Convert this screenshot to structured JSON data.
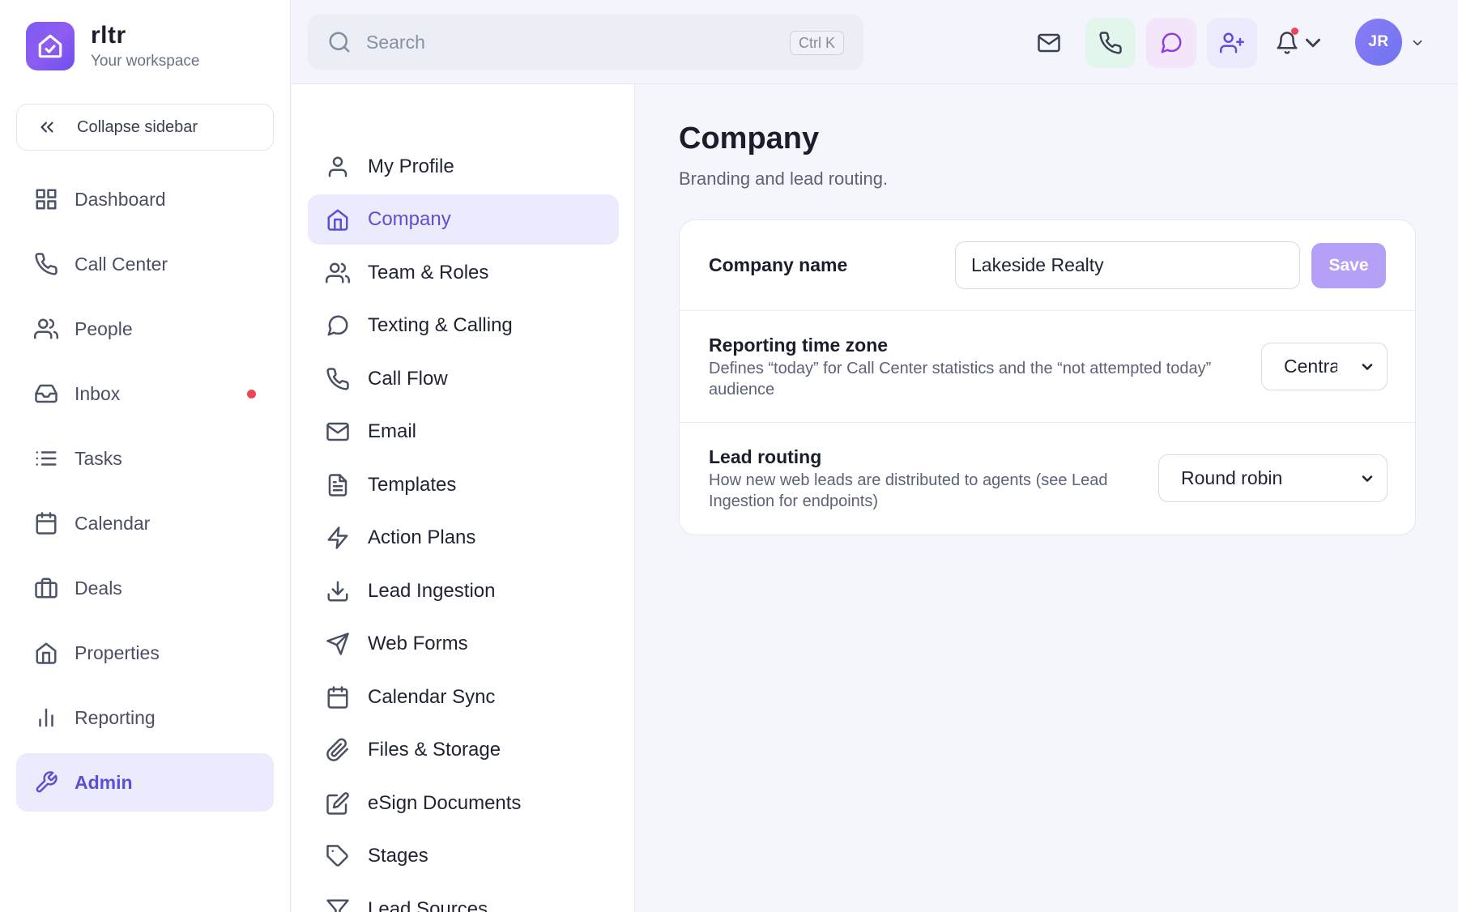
{
  "app": {
    "name": "rltr",
    "workspace": "Your workspace"
  },
  "sidebar": {
    "collapse_label": "Collapse sidebar",
    "items": [
      {
        "label": "Dashboard",
        "icon": "grid-icon"
      },
      {
        "label": "Call Center",
        "icon": "phone-icon"
      },
      {
        "label": "People",
        "icon": "users-icon"
      },
      {
        "label": "Inbox",
        "icon": "inbox-icon",
        "badge": "unread-dot"
      },
      {
        "label": "Tasks",
        "icon": "list-icon"
      },
      {
        "label": "Calendar",
        "icon": "calendar-icon"
      },
      {
        "label": "Deals",
        "icon": "briefcase-icon"
      },
      {
        "label": "Properties",
        "icon": "home-icon"
      },
      {
        "label": "Reporting",
        "icon": "bar-chart-icon"
      },
      {
        "label": "Admin",
        "icon": "wrench-icon",
        "active": true
      }
    ]
  },
  "topbar": {
    "search_placeholder": "Search",
    "search_shortcut": "Ctrl K",
    "avatar_initials": "JR"
  },
  "settings_nav": {
    "items": [
      {
        "label": "My Profile",
        "icon": "user-icon"
      },
      {
        "label": "Company",
        "icon": "home-icon",
        "active": true
      },
      {
        "label": "Team & Roles",
        "icon": "users-icon"
      },
      {
        "label": "Texting & Calling",
        "icon": "chat-bubble-icon"
      },
      {
        "label": "Call Flow",
        "icon": "phone-icon"
      },
      {
        "label": "Email",
        "icon": "mail-icon"
      },
      {
        "label": "Templates",
        "icon": "document-icon"
      },
      {
        "label": "Action Plans",
        "icon": "lightning-icon"
      },
      {
        "label": "Lead Ingestion",
        "icon": "download-icon"
      },
      {
        "label": "Web Forms",
        "icon": "send-icon"
      },
      {
        "label": "Calendar Sync",
        "icon": "calendar-icon"
      },
      {
        "label": "Files & Storage",
        "icon": "paperclip-icon"
      },
      {
        "label": "eSign Documents",
        "icon": "edit-icon"
      },
      {
        "label": "Stages",
        "icon": "tag-icon"
      },
      {
        "label": "Lead Sources",
        "icon": "filter-icon"
      }
    ]
  },
  "main": {
    "title": "Company",
    "subtitle": "Branding and lead routing.",
    "company_name": {
      "label": "Company name",
      "value": "Lakeside Realty",
      "save_label": "Save"
    },
    "timezone": {
      "label": "Reporting time zone",
      "description": "Defines “today” for Call Center statistics and the “not attempted today” audience",
      "value": "Central"
    },
    "lead_routing": {
      "label": "Lead routing",
      "description": "How new web leads are distributed to agents (see Lead Ingestion for endpoints)",
      "value": "Round robin"
    }
  },
  "colors": {
    "accent": "#5b4fd6",
    "accent_bg": "#eceafd",
    "save_button": "#b4a0f6",
    "alert_dot": "#ef4356",
    "logo": "#7c5cf5"
  }
}
